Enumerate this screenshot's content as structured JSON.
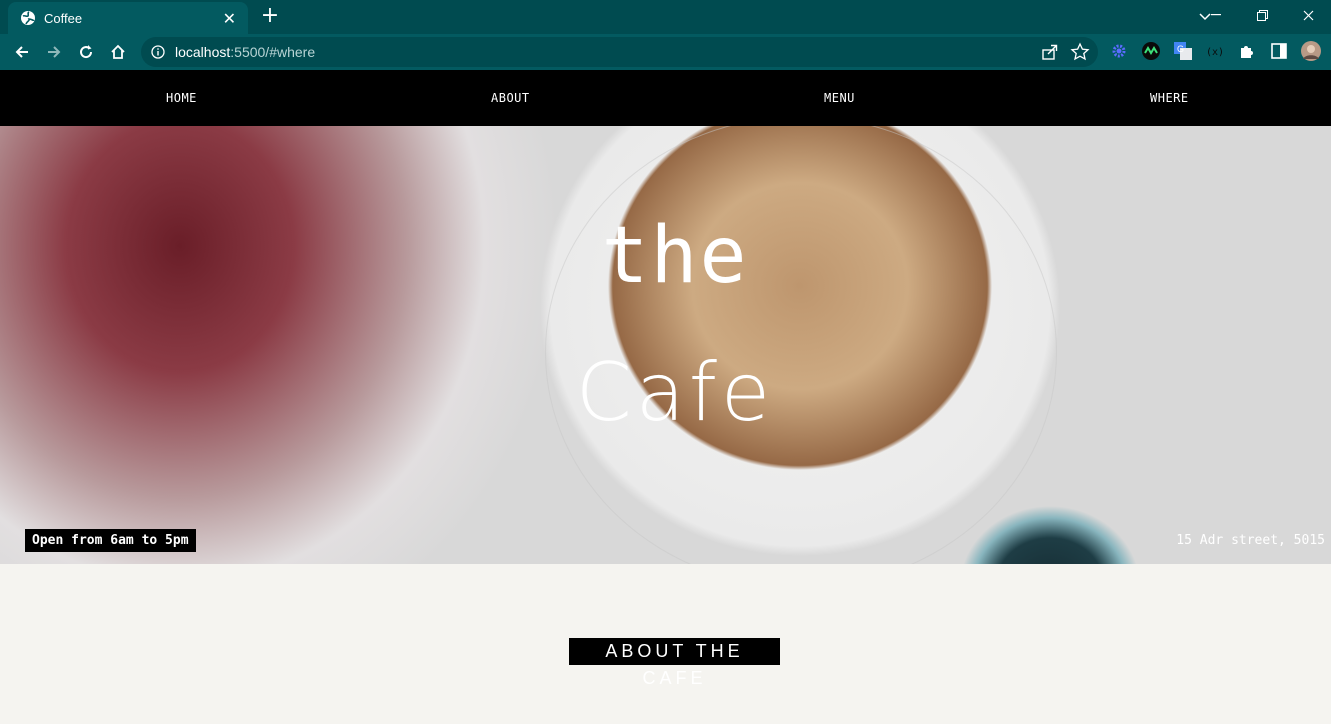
{
  "browser": {
    "tab_title": "Coffee",
    "tab_close": "✕",
    "new_tab": "+",
    "url_host": "localhost",
    "url_rest": ":5500/#where",
    "colors": {
      "frame": "#004b50",
      "toolbar": "#035a60"
    }
  },
  "nav": {
    "items": [
      "HOME",
      "ABOUT",
      "MENU",
      "WHERE"
    ]
  },
  "hero": {
    "line1": "the",
    "line2": "Cafe",
    "hours": "Open from 6am to 5pm",
    "address": "15 Adr street, 5015"
  },
  "about": {
    "title": "ABOUT THE CAFE"
  }
}
